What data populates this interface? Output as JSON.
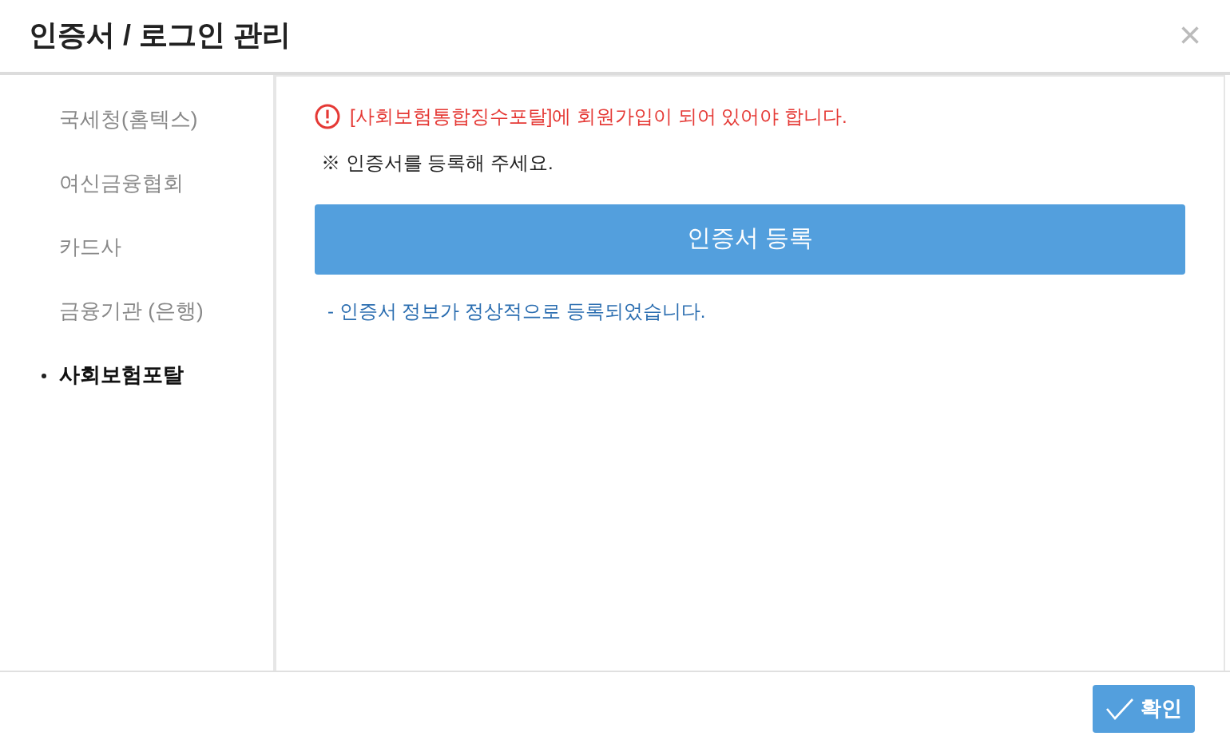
{
  "window": {
    "title": "인증서 / 로그인 관리",
    "close": "×"
  },
  "sidebar": {
    "items": [
      {
        "label": "국세청(홈텍스)",
        "selected": false
      },
      {
        "label": "여신금융협회",
        "selected": false
      },
      {
        "label": "카드사",
        "selected": false
      },
      {
        "label": "금융기관 (은행)",
        "selected": false
      },
      {
        "label": "사회보험포탈",
        "selected": true
      }
    ]
  },
  "content": {
    "warning": "[사회보험통합징수포탈]에 회원가입이 되어 있어야 합니다.",
    "notice": "※ 인증서를 등록해 주세요.",
    "register_button": "인증서 등록",
    "status": "- 인증서 정보가 정상적으로 등록되었습니다."
  },
  "footer": {
    "confirm_button": "확인"
  }
}
